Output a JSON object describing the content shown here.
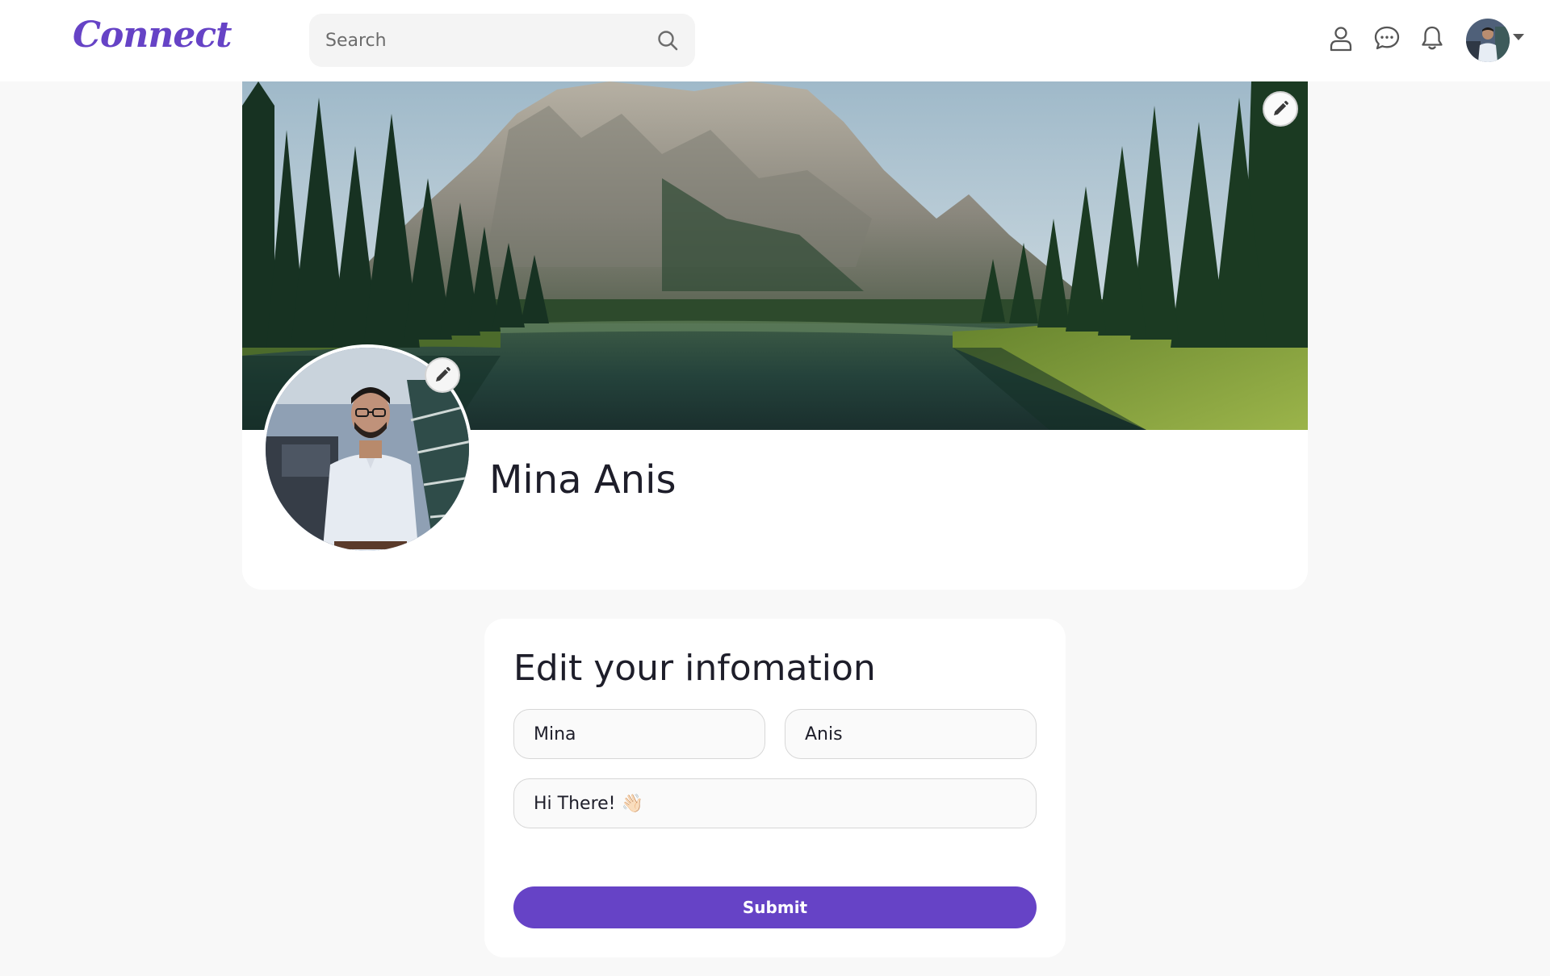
{
  "header": {
    "logo": "Connect",
    "search": {
      "placeholder": "Search",
      "value": ""
    }
  },
  "profile": {
    "name": "Mina Anis"
  },
  "form": {
    "title": "Edit your infomation",
    "first_name": "Mina",
    "last_name": "Anis",
    "bio": "Hi There! 👋🏻",
    "submit_label": "Submit"
  },
  "colors": {
    "accent": "#6643c6",
    "page_background": "#f8f8f8",
    "card_background": "#ffffff"
  },
  "icons": {
    "search": "search-icon",
    "profile": "user-icon",
    "messages": "chat-icon",
    "notifications": "bell-icon",
    "menu": "chevron-down-icon",
    "edit": "pencil-icon"
  }
}
